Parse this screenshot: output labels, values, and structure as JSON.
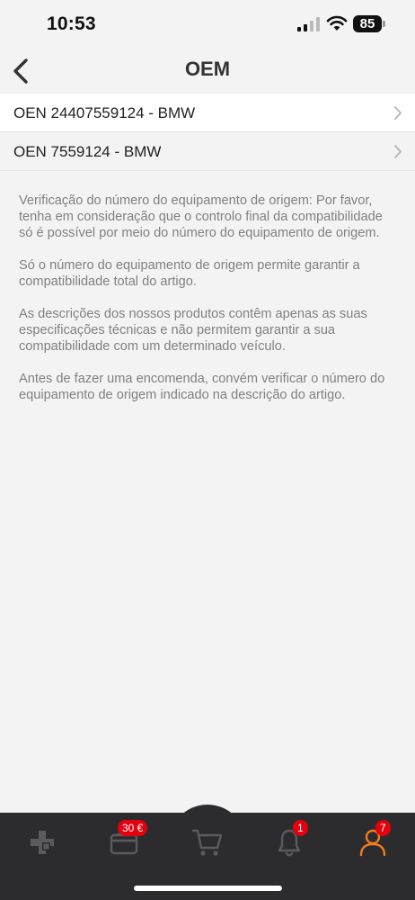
{
  "status_bar": {
    "time": "10:53",
    "battery": "85"
  },
  "header": {
    "title": "OEM"
  },
  "oem_items": [
    {
      "label": "OEN 24407559124 - BMW"
    },
    {
      "label": "OEN 7559124 - BMW"
    }
  ],
  "info_paragraphs": [
    "Verificação do número do equipamento de origem: Por favor, tenha em consideração que o controlo final da compatibilidade só é possível por meio do número do equipamento de origem.",
    "Só o número do equipamento de origem permite garantir a compatibilidade total do artigo.",
    "As descrições dos nossos produtos contêm apenas as suas especificações técnicas e não permitem garantir a sua compatibilidade com um determinado veículo.",
    "Antes de fazer uma encomenda, convém verificar o número do equipamento de origem indicado na descrição do artigo."
  ],
  "bottom_nav": {
    "items": [
      {
        "icon": "catalog-icon"
      },
      {
        "icon": "wallet-icon",
        "badge": "30 €"
      },
      {
        "icon": "cart-icon"
      },
      {
        "icon": "bell-icon",
        "badge": "1"
      },
      {
        "icon": "profile-icon",
        "badge": "7"
      }
    ]
  },
  "colors": {
    "accent": "#f47b20",
    "badge": "#e3000f",
    "nav_bg": "#2c2c2e",
    "nav_icon": "#5b5b5f"
  }
}
